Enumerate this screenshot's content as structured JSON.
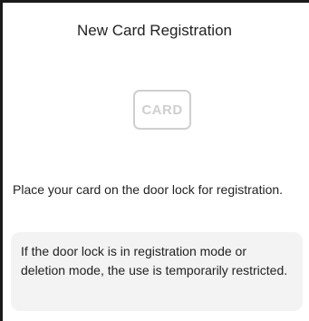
{
  "screen": {
    "title": "New Card Registration"
  },
  "card_icon": {
    "label": "CARD",
    "icon": "card-icon"
  },
  "instruction": {
    "text": "Place your card on the door lock for registration."
  },
  "notice": {
    "text": "If the door lock is in registration mode or deletion mode, the use is temporarily restricted."
  },
  "colors": {
    "background": "#ffffff",
    "text": "#222222",
    "icon_gray": "#cfcfcf",
    "notice_bg": "#f3f3f3",
    "frame": "#1a1a1a"
  }
}
